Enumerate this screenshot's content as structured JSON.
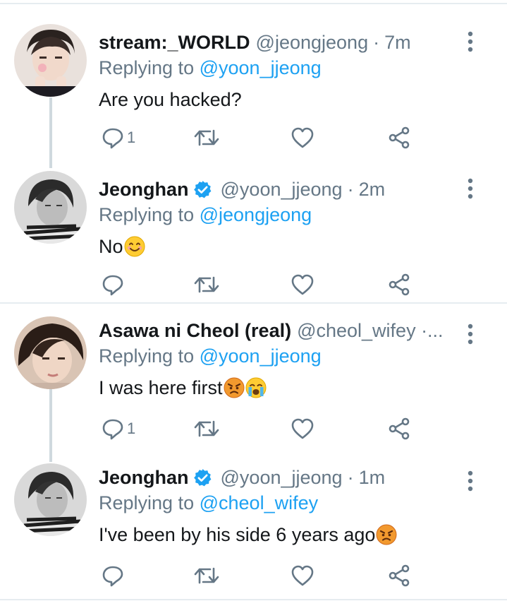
{
  "colors": {
    "accent": "#1da1f2",
    "muted": "#657786",
    "text": "#14171a",
    "divider": "#e6ecf0"
  },
  "tweets": [
    {
      "name": "stream:_WORLD",
      "handle": "@jeongjeong",
      "separator": "·",
      "time": "7m",
      "verified": false,
      "reply_prefix": "Replying to",
      "reply_to": "@yoon_jjeong",
      "text": "Are you hacked?",
      "emojis": [],
      "reply_count": "1",
      "icons": [
        "reply-icon",
        "retweet-icon",
        "like-icon",
        "share-icon",
        "more-icon"
      ]
    },
    {
      "name": "Jeonghan",
      "handle": "@yoon_jjeong",
      "separator": "·",
      "time": "2m",
      "verified": true,
      "reply_prefix": "Replying to",
      "reply_to": "@jeongjeong",
      "text": "No",
      "emojis": [
        "smiling-face"
      ],
      "reply_count": "",
      "icons": [
        "reply-icon",
        "retweet-icon",
        "like-icon",
        "share-icon",
        "more-icon"
      ]
    },
    {
      "name": "Asawa ni Cheol (real)",
      "handle": "@cheol_wifey ·...",
      "separator": "",
      "time": "",
      "verified": false,
      "reply_prefix": "Replying to",
      "reply_to": "@yoon_jjeong",
      "text": "I was here first",
      "emojis": [
        "angry-face",
        "crying-face"
      ],
      "reply_count": "1",
      "icons": [
        "reply-icon",
        "retweet-icon",
        "like-icon",
        "share-icon",
        "more-icon"
      ]
    },
    {
      "name": "Jeonghan",
      "handle": "@yoon_jjeong",
      "separator": "·",
      "time": "1m",
      "verified": true,
      "reply_prefix": "Replying to",
      "reply_to": "@cheol_wifey",
      "text": "I've been by his side 6 years ago",
      "emojis": [
        "angry-face"
      ],
      "reply_count": "",
      "icons": [
        "reply-icon",
        "retweet-icon",
        "like-icon",
        "share-icon",
        "more-icon"
      ]
    }
  ]
}
